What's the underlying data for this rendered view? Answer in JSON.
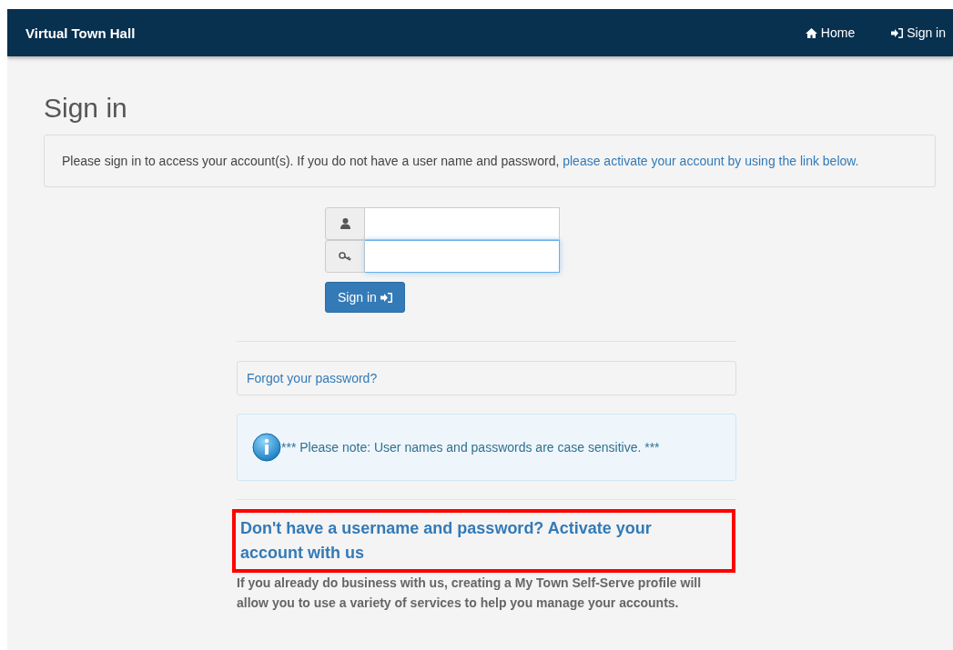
{
  "navbar": {
    "brand": "Virtual Town Hall",
    "links": [
      {
        "kind": "home",
        "label": "Home"
      },
      {
        "kind": "signin",
        "label": "Sign in"
      }
    ]
  },
  "heading": "Sign in",
  "intro": {
    "text": "Please sign in to access your account(s). If you do not have a user name and password, ",
    "link": "please activate your account by using the link below."
  },
  "form": {
    "fields": [
      {
        "kind": "user",
        "focused": false
      },
      {
        "kind": "key",
        "focused": true
      }
    ],
    "submit": "Sign in"
  },
  "forgot_link": "Forgot your password?",
  "note": "*** Please note: User names and passwords are case sensitive. ***",
  "activate": {
    "title": "Don't have a username and password? Activate your account with us",
    "highlighted": true,
    "body": "If you already do business with us, creating a My Town Self-Serve profile will allow you to use a variety of services to help you manage your accounts."
  }
}
